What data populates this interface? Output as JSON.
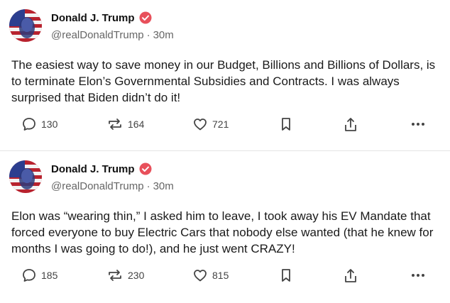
{
  "posts": [
    {
      "author": "Donald J. Trump",
      "handle": "@realDonaldTrump",
      "separator": "·",
      "time": "30m",
      "text": "The easiest way to save money in our Budget, Billions and Billions of Dollars, is to terminate Elon’s Governmental Subsidies and Contracts. I was always surprised that Biden didn’t do it!",
      "replies": "130",
      "reposts": "164",
      "likes": "721",
      "icons": [
        "reply-icon",
        "repost-icon",
        "like-icon",
        "bookmark-icon",
        "share-icon",
        "more-icon"
      ]
    },
    {
      "author": "Donald J. Trump",
      "handle": "@realDonaldTrump",
      "separator": "·",
      "time": "30m",
      "text": "Elon was “wearing thin,” I asked him to leave, I took away his EV Mandate that forced everyone to buy Electric Cars that nobody else wanted (that he knew for months I was going to do!), and he just went CRAZY!",
      "replies": "185",
      "reposts": "230",
      "likes": "815",
      "icons": [
        "reply-icon",
        "repost-icon",
        "like-icon",
        "bookmark-icon",
        "share-icon",
        "more-icon"
      ]
    }
  ],
  "colors": {
    "verified": "#e8505b",
    "icon": "#444444",
    "divider": "#e3e3e3"
  }
}
